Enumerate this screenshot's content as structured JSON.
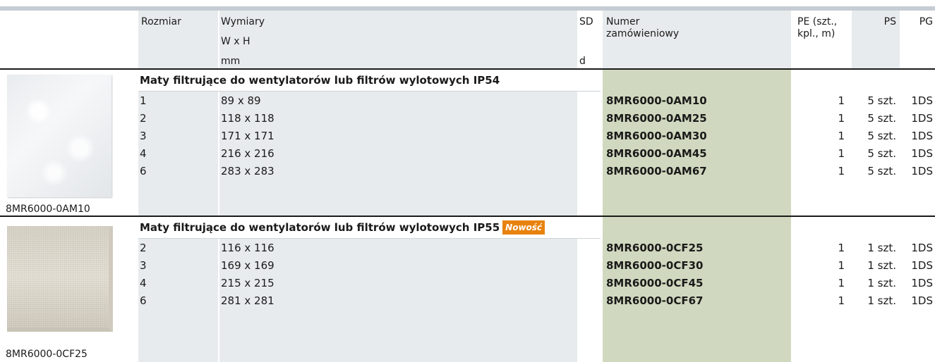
{
  "header": {
    "col_size": "Rozmiar",
    "col_dims_line1": "Wymiary",
    "col_dims_line2": "W x H",
    "col_dims_unit": "mm",
    "col_sd": "SD",
    "col_sd_unit": "d",
    "col_number_line1": "Numer",
    "col_number_line2": "zamówieniowy",
    "col_pe_line1": "PE (szt.,",
    "col_pe_line2": "kpl., m)",
    "col_ps": "PS",
    "col_pg": "PG"
  },
  "sections": [
    {
      "title": "Maty filtrujące do wentylatorów lub filtrów wylotowych IP54",
      "badge": "",
      "image_caption": "8MR6000-0AM10",
      "rows": [
        {
          "size": "1",
          "dims": "89 x 89",
          "number": "8MR6000-0AM10",
          "pe": "1",
          "ps": "5 szt.",
          "pg": "1DS"
        },
        {
          "size": "2",
          "dims": "118 x 118",
          "number": "8MR6000-0AM25",
          "pe": "1",
          "ps": "5 szt.",
          "pg": "1DS"
        },
        {
          "size": "3",
          "dims": "171 x 171",
          "number": "8MR6000-0AM30",
          "pe": "1",
          "ps": "5 szt.",
          "pg": "1DS"
        },
        {
          "size": "4",
          "dims": "216 x 216",
          "number": "8MR6000-0AM45",
          "pe": "1",
          "ps": "5 szt.",
          "pg": "1DS"
        },
        {
          "size": "6",
          "dims": "283 x 283",
          "number": "8MR6000-0AM67",
          "pe": "1",
          "ps": "5 szt.",
          "pg": "1DS"
        }
      ]
    },
    {
      "title": "Maty filtrujące do wentylatorów lub filtrów wylotowych IP55",
      "badge": "Nowość",
      "image_caption": "8MR6000-0CF25",
      "rows": [
        {
          "size": "2",
          "dims": "116 x 116",
          "number": "8MR6000-0CF25",
          "pe": "1",
          "ps": "1 szt.",
          "pg": "1DS"
        },
        {
          "size": "3",
          "dims": "169 x 169",
          "number": "8MR6000-0CF30",
          "pe": "1",
          "ps": "1 szt.",
          "pg": "1DS"
        },
        {
          "size": "4",
          "dims": "215 x 215",
          "number": "8MR6000-0CF45",
          "pe": "1",
          "ps": "1 szt.",
          "pg": "1DS"
        },
        {
          "size": "6",
          "dims": "281 x 281",
          "number": "8MR6000-0CF67",
          "pe": "1",
          "ps": "1 szt.",
          "pg": "1DS"
        }
      ]
    }
  ],
  "colors": {
    "order_number_column": "#d0d9bf",
    "column_shade": "#e8ebed",
    "badge": "#e8820e"
  }
}
